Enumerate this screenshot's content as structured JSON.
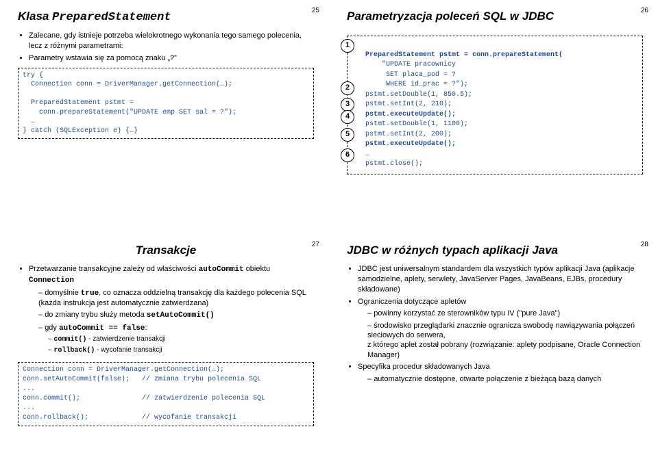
{
  "slide25": {
    "num": "25",
    "title_pre": "Klasa ",
    "title_mono": "PreparedStatement",
    "b1": "Zalecane, gdy istnieje potrzeba wielokrotnego wykonania tego samego polecenia, lecz z różnymi parametrami:",
    "b2": "Parametry wstawia się za pomocą znaku „?”",
    "code": "try {\n  Connection conn = DriverManager.getConnection(…);\n\n  PreparedStatement pstmt =\n    conn.prepareStatement(\"UPDATE emp SET sal = ?\");\n  …\n} catch (SQLException e) {…}"
  },
  "slide26": {
    "num": "26",
    "title": "Parametryzacja poleceń SQL w JDBC",
    "n1": "1",
    "n2": "2",
    "n3": "3",
    "n4": "4",
    "n5": "5",
    "n6": "6",
    "l1": "PreparedStatement pstmt = conn.prepareStatement(",
    "l2": "    \"UPDATE pracownicy",
    "l3": "     SET placa_pod = ?",
    "l4": "     WHERE id_prac = ?\");",
    "l5": "pstmt.setDouble(1, 850.5);",
    "l6": "pstmt.setInt(2, 210);",
    "l7": "pstmt.executeUpdate();",
    "l8": "pstmt.setDouble(1, 1100);",
    "l9": "pstmt.setInt(2, 200);",
    "l10": "pstmt.executeUpdate();",
    "l11": "…",
    "l12": "pstmt.close();"
  },
  "slide27": {
    "num": "27",
    "title": "Transakcje",
    "b1_pre": "Przetwarzanie transakcyjne zależy od właściwości ",
    "b1_m1": "autoCommit",
    "b1_mid": " obiektu ",
    "b1_m2": "Connection",
    "d1_pre": "domyślnie ",
    "d1_m": "true",
    "d1_post": ", co oznacza oddzielną transakcję dla każdego polecenia SQL (każda instrukcja jest automatycznie zatwierdzana)",
    "d2_pre": "do zmiany trybu służy metoda ",
    "d2_m": "setAutoCommit()",
    "d3_pre": "gdy ",
    "d3_m": "autoCommit == false",
    "d3_post": ":",
    "dd1_m": "commit()",
    "dd1_t": " - zatwierdzenie transakcji",
    "dd2_m": "rollback()",
    "dd2_t": " - wycofanie transakcji",
    "code": "Connection conn = DriverManager.getConnection(…);\nconn.setAutoCommit(false);   // zmiana trybu polecenia SQL\n...\nconn.commit();               // zatwierdzenie polecenia SQL\n...\nconn.rollback();             // wycofanie transakcji"
  },
  "slide28": {
    "num": "28",
    "title": "JDBC w różnych typach aplikacji Java",
    "b1": "JDBC jest uniwersalnym standardem dla wszystkich typów aplikacji Java (aplikacje samodzielne, aplety, serwlety, JavaServer Pages, JavaBeans, EJBs, procedury składowane)",
    "b2": "Ograniczenia dotyczące apletów",
    "d1": "powinny korzystać ze sterowników typu IV (\"pure Java\")",
    "d2": "środowisko przeglądarki znacznie ogranicza swobodę nawiązywania połączeń sieciowych do serwera,",
    "d2b": "z którego aplet został pobrany (rozwiązanie: aplety podpisane, Oracle Connection Manager)",
    "b3": "Specyfika procedur składowanych Java",
    "d3": "automatycznie dostępne, otwarte połączenie z bieżącą bazą danych"
  }
}
